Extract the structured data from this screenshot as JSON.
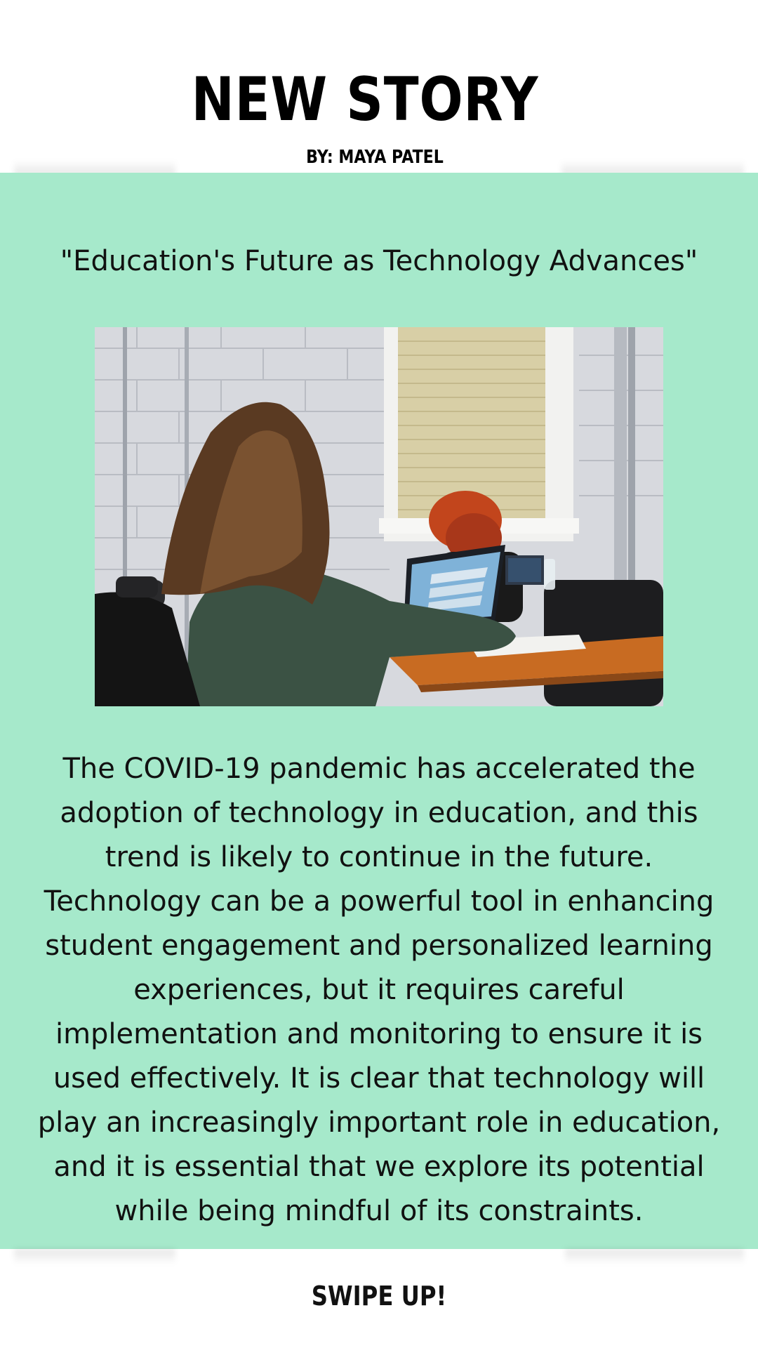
{
  "header": {
    "title": "NEW STORY",
    "byline": "BY: MAYA PATEL"
  },
  "article": {
    "headline": "\"Education's Future as  Technology Advances\"",
    "body": "The COVID-19 pandemic has accelerated the adoption of technology in education, and this trend is likely to continue in the future. Technology can be a powerful tool in enhancing student engagement and personalized learning experiences, but it requires careful implementation and monitoring to ensure it is used effectively. It is clear that technology will play an increasingly important role in education, and it is essential that we explore its potential while being mindful of its constraints."
  },
  "footer": {
    "cta": "SWIPE UP!"
  },
  "colors": {
    "panel_background": "#a6e9cb",
    "page_background": "#ffffff",
    "text": "#111111"
  }
}
